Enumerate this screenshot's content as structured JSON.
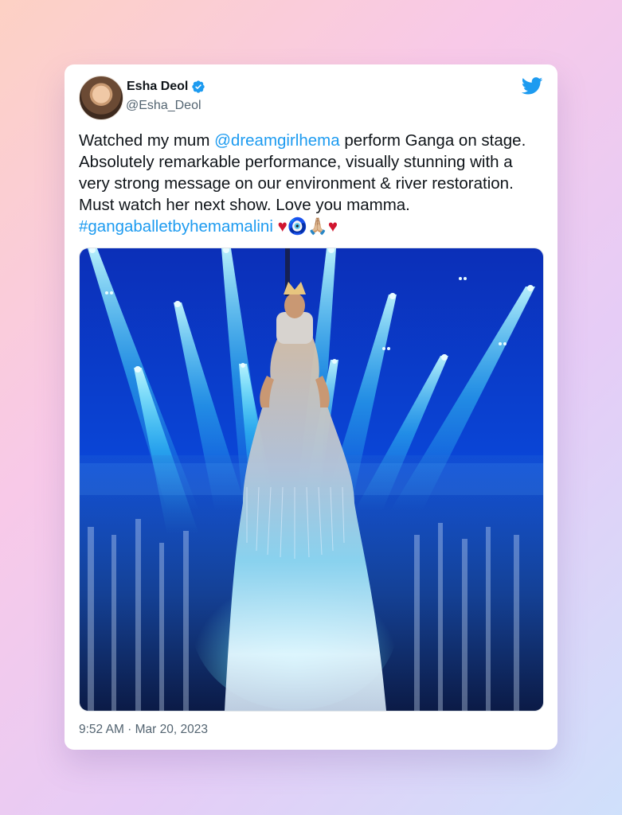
{
  "author": {
    "name": "Esha Deol",
    "handle": "@Esha_Deol",
    "verified": true
  },
  "tweet": {
    "text_1": "Watched my mum ",
    "mention": "@dreamgirlhema",
    "text_2": " perform Ganga on stage. Absolutely remarkable performance, visually stunning with a very strong message on our environment & river restoration. Must watch her next show. Love you mamma. ",
    "hashtag": "#gangaballetbyhemamalini",
    "emoji_1": "♥",
    "emoji_2": "🧿",
    "emoji_3": "🙏🏼",
    "emoji_4": "♥"
  },
  "timestamp": "9:52 AM · Mar 20, 2023",
  "colors": {
    "link": "#1d9bf0",
    "verified_badge": "#1d9bf0",
    "twitter_bird": "#1d9bf0",
    "heart": "#d1162f",
    "stage_blue": "#0a3cc8",
    "spotlight_cyan": "#3ee7ff"
  },
  "icons": {
    "brand": "twitter-bird-icon",
    "badge": "verified-badge-icon"
  }
}
